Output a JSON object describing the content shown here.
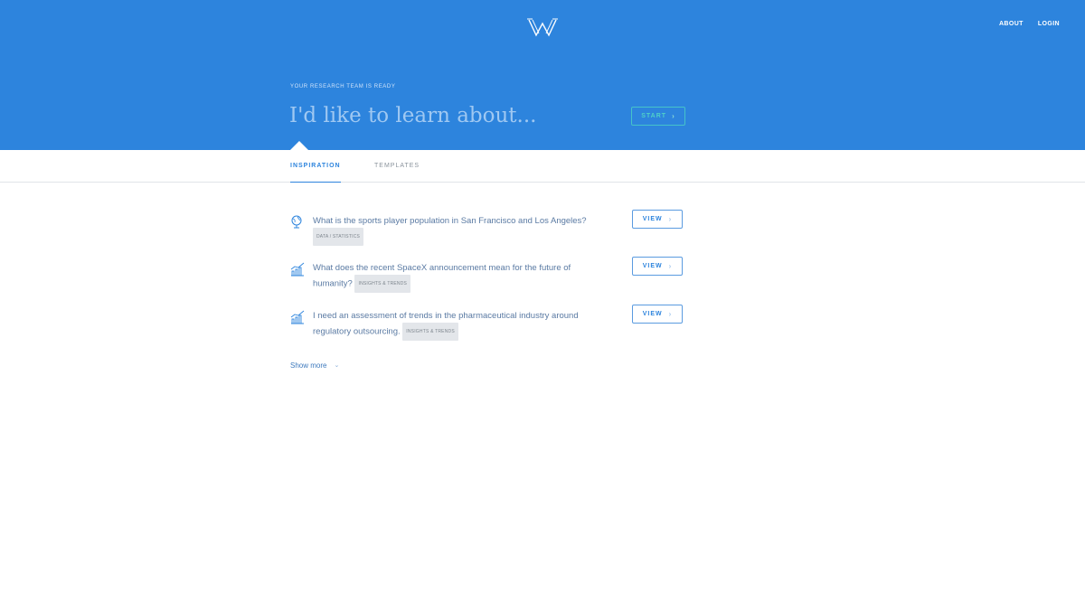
{
  "header": {
    "nav": {
      "about": "ABOUT",
      "login": "LOGIN"
    },
    "eyebrow": "YOUR RESEARCH TEAM IS READY",
    "search_placeholder": "I'd like to learn about...",
    "start_label": "START",
    "colors": {
      "background": "#2d84dd",
      "start_accent": "#4fd0c8"
    }
  },
  "tabs": [
    {
      "label": "INSPIRATION",
      "active": true
    },
    {
      "label": "TEMPLATES",
      "active": false
    }
  ],
  "items": [
    {
      "icon": "globe-icon",
      "question": "What is the sports player population in San Francisco and Los Angeles?",
      "tag": "DATA / STATISTICS",
      "button": "VIEW"
    },
    {
      "icon": "bar-chart-icon",
      "question": "What does the recent SpaceX announcement mean for the future of humanity?",
      "tag": "INSIGHTS & TRENDS",
      "button": "VIEW"
    },
    {
      "icon": "bar-chart-icon",
      "question": "I need an assessment of trends in the pharmaceutical industry around regulatory outsourcing.",
      "tag": "INSIGHTS & TRENDS",
      "button": "VIEW"
    }
  ],
  "show_more": "Show more"
}
